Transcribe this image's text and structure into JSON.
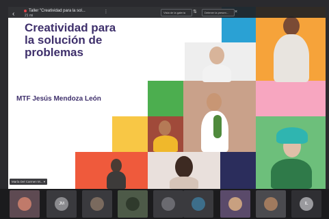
{
  "meeting": {
    "title": "Taller \"Creatividad para la sol...",
    "subtitle": "21 mi",
    "select_a": "Vista de la galería",
    "select_b": "Detener la presen..."
  },
  "slide": {
    "title": "Creatividad para la solución de problemas",
    "author": "MTF Jesús Mendoza León"
  },
  "presenter_tag": "María Del Carmen M...",
  "participants": [
    {
      "initials": "",
      "color": "#6b5b6e"
    },
    {
      "initials": "JM",
      "color": "#8a8a8e"
    },
    {
      "initials": "",
      "color": "#5a5a5e"
    },
    {
      "initials": "",
      "color": "#4d5a48"
    },
    {
      "initials": "",
      "color": "#55555a"
    },
    {
      "initials": "",
      "color": "#3d6e8a"
    },
    {
      "initials": "",
      "color": "#5a4a6a"
    },
    {
      "initials": "",
      "color": "#4a4a4e"
    },
    {
      "initials": "IL",
      "color": "#9a9a9e"
    }
  ],
  "colors": {
    "slide_text": "#3e2f6b",
    "orange": "#f6a33a",
    "pink": "#f7a6c0",
    "blue": "#2aa1d4",
    "green": "#4cae4f",
    "yellow": "#f8c745",
    "red": "#ef5a3c"
  }
}
